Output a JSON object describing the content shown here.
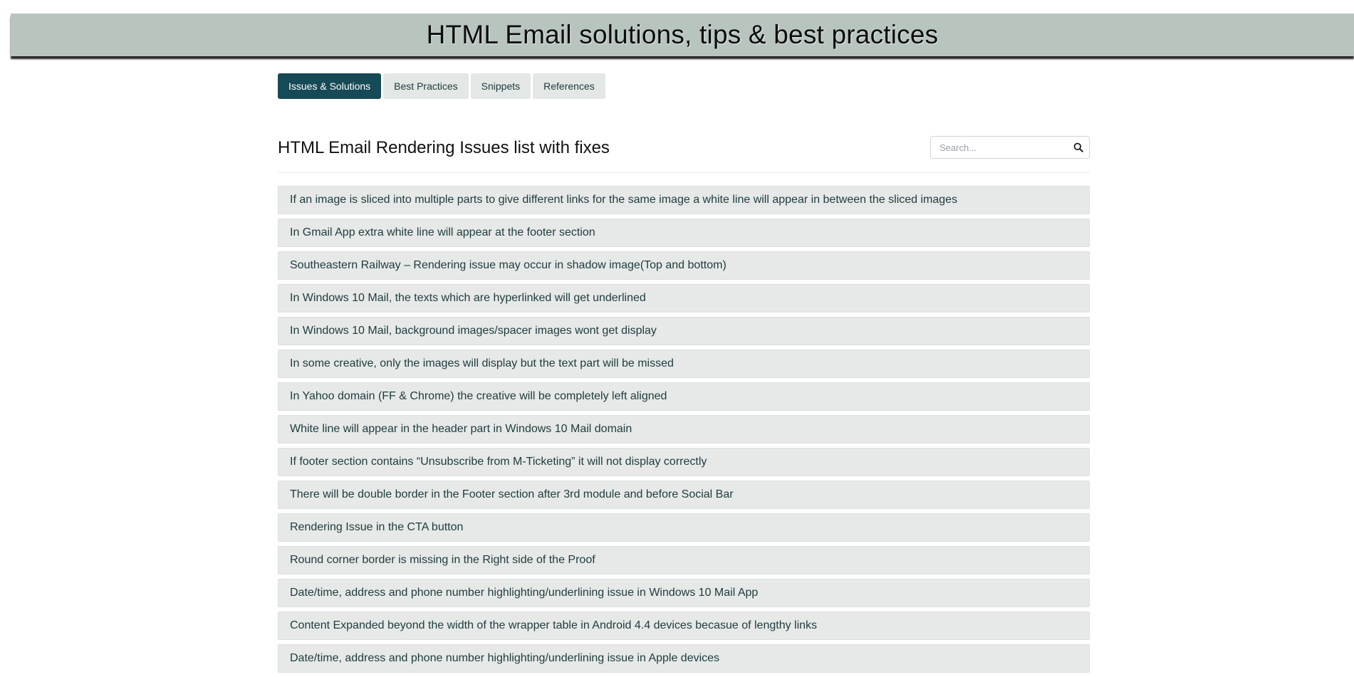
{
  "header": {
    "title": "HTML Email solutions, tips & best practices"
  },
  "tabs": [
    {
      "label": "Issues & Solutions",
      "active": true
    },
    {
      "label": "Best Practices",
      "active": false
    },
    {
      "label": "Snippets",
      "active": false
    },
    {
      "label": "References",
      "active": false
    }
  ],
  "main": {
    "title": "HTML Email Rendering Issues list with fixes",
    "search": {
      "placeholder": "Search...",
      "value": "",
      "icon": "search-icon"
    },
    "issues": [
      "If an image is sliced into multiple parts to give different links for the same image a white line will appear in between the sliced images",
      "In Gmail App extra white line will appear at the footer section",
      "Southeastern Railway – Rendering issue may occur in shadow image(Top and bottom)",
      "In Windows 10 Mail, the texts which are hyperlinked will get underlined",
      "In Windows 10 Mail, background images/spacer images wont get display",
      "In some creative, only the images will display but the text part will be missed",
      "In Yahoo domain (FF & Chrome) the creative will be completely left aligned",
      "White line will appear in the header part in Windows 10 Mail domain",
      "If footer section contains “Unsubscribe from M-Ticketing” it will not display correctly",
      "There will be double border in the Footer section after 3rd module and before Social Bar",
      "Rendering Issue in the CTA button",
      "Round corner border is missing in the Right side of the Proof",
      "Date/time, address and phone number highlighting/underlining issue in Windows 10 Mail App",
      "Content Expanded beyond the width of the wrapper table in Android 4.4 devices becasue of lengthy links",
      "Date/time, address and phone number highlighting/underlining issue in Apple devices"
    ]
  },
  "colors": {
    "banner": "#b8c5bf",
    "active_tab": "#174a57",
    "tab": "#e3e7e5",
    "item": "#e6e9e7",
    "text": "#1e3b3f"
  }
}
